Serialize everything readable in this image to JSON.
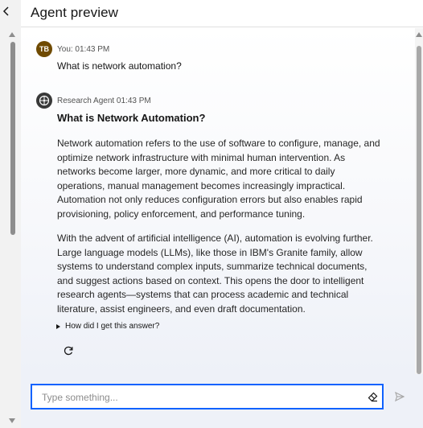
{
  "header": {
    "title": "Agent preview"
  },
  "conversation": {
    "user_message": {
      "avatar_initials": "TB",
      "meta": "You: 01:43 PM",
      "text": "What is network automation?"
    },
    "agent_message": {
      "meta": "Research Agent 01:43 PM",
      "title": "What is Network Automation?",
      "paragraph_1": "Network automation refers to the use of software to configure, manage, and optimize network infrastructure with minimal human intervention. As networks become larger, more dynamic, and more critical to daily operations, manual management becomes increasingly impractical. Automation not only reduces configuration errors but also enables rapid provisioning, policy enforcement, and performance tuning.",
      "paragraph_2": "With the advent of artificial intelligence (AI), automation is evolving further. Large language models (LLMs), like those in IBM's Granite family, allow systems to understand complex inputs, summarize technical documents, and suggest actions based on context. This opens the door to intelligent research agents—systems that can process academic and technical literature, assist engineers, and even draft documentation.",
      "details_label": "How did I get this answer?"
    }
  },
  "input": {
    "placeholder": "Type something...",
    "value": ""
  },
  "icons": {
    "back": "chevron-left-icon",
    "agent_avatar": "agent-icon",
    "retry": "refresh-icon",
    "clear": "eraser-icon",
    "send": "send-icon"
  },
  "colors": {
    "accent": "#0f62fe",
    "user_avatar": "#6f4a00",
    "agent_avatar": "#393939"
  }
}
